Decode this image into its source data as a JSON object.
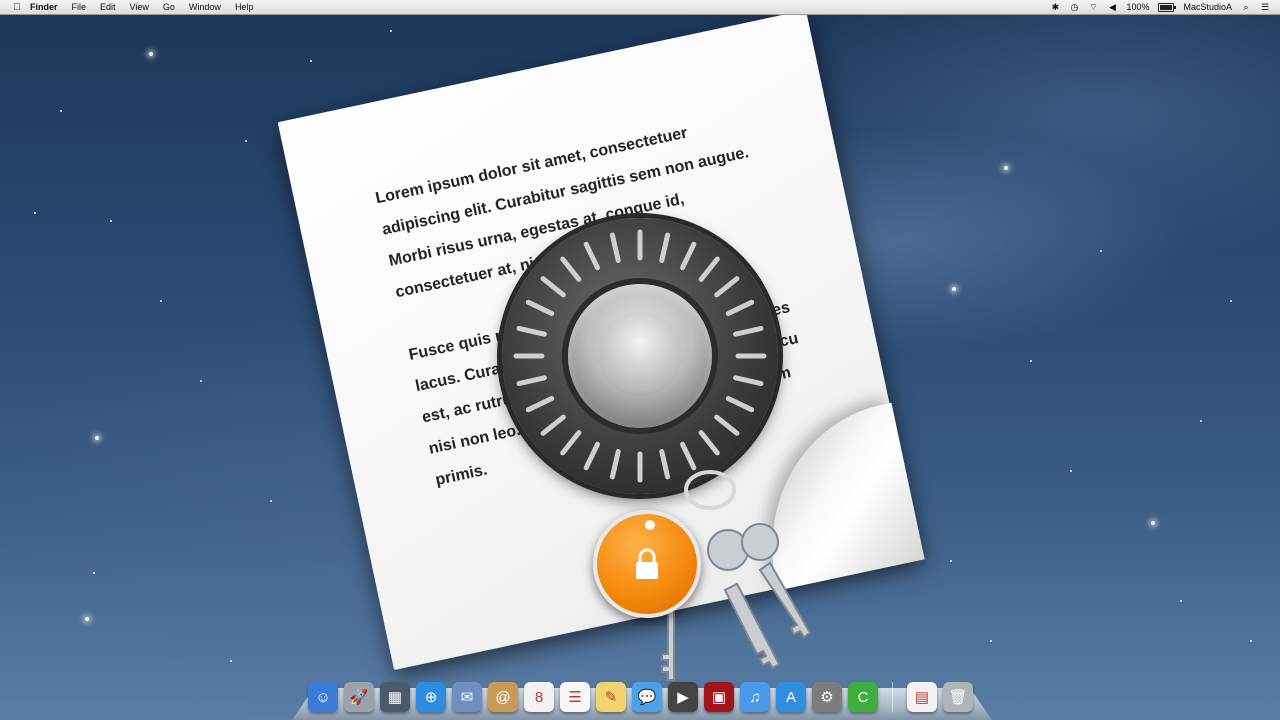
{
  "menubar": {
    "apple_icon": "apple-icon",
    "app_name": "Finder",
    "menus": [
      "File",
      "Edit",
      "View",
      "Go",
      "Window",
      "Help"
    ],
    "battery_text": "100%",
    "user_name": "MacStudioA"
  },
  "document": {
    "paragraph_1": "Lorem ipsum dolor sit amet, consectetuer adipiscing elit. Curabitur sagittis sem non augue. Morbi risus urna, egestas at, congue id, consectetuer at, nisl.",
    "paragraph_2": "Fusce quis mi. Pellentesque at erat. Morbi non lacus. Curabitur mauris, lacinia, lacus erat ultrices est, ac rutrum mattis mauris. Nam adipiscing, arcu nisi non leo. tempus nisi. Vestibulum ante ipsum primis."
  },
  "dock": {
    "items": [
      {
        "name": "finder-icon",
        "glyph": "☺",
        "color": "#3a7bd5"
      },
      {
        "name": "launchpad-icon",
        "glyph": "🚀",
        "color": "#9aa3ad"
      },
      {
        "name": "mission-control-icon",
        "glyph": "▦",
        "color": "#4a5a6a"
      },
      {
        "name": "safari-icon",
        "glyph": "⊕",
        "color": "#2d8de0"
      },
      {
        "name": "mail-icon",
        "glyph": "✉",
        "color": "#6e8fbf"
      },
      {
        "name": "contacts-icon",
        "glyph": "@",
        "color": "#c89a55"
      },
      {
        "name": "calendar-icon",
        "glyph": "8",
        "color": "#f2f2f2"
      },
      {
        "name": "reminders-icon",
        "glyph": "☰",
        "color": "#f7f7f7"
      },
      {
        "name": "notes-icon",
        "glyph": "✎",
        "color": "#f0d36b"
      },
      {
        "name": "messages-icon",
        "glyph": "💬",
        "color": "#4aa3e8"
      },
      {
        "name": "facetime-icon",
        "glyph": "▶",
        "color": "#444"
      },
      {
        "name": "photo-booth-icon",
        "glyph": "▣",
        "color": "#a3141a"
      },
      {
        "name": "itunes-icon",
        "glyph": "♫",
        "color": "#4a98e6"
      },
      {
        "name": "app-store-icon",
        "glyph": "A",
        "color": "#2f8ee0"
      },
      {
        "name": "system-preferences-icon",
        "glyph": "⚙",
        "color": "#7c7c7c"
      },
      {
        "name": "camtasia-icon",
        "glyph": "C",
        "color": "#3fae3f"
      }
    ],
    "right_items": [
      {
        "name": "document-icon",
        "glyph": "▤",
        "color": "#f2f2f2"
      },
      {
        "name": "trash-icon",
        "glyph": "🗑",
        "color": "#aeb4ba"
      }
    ]
  }
}
